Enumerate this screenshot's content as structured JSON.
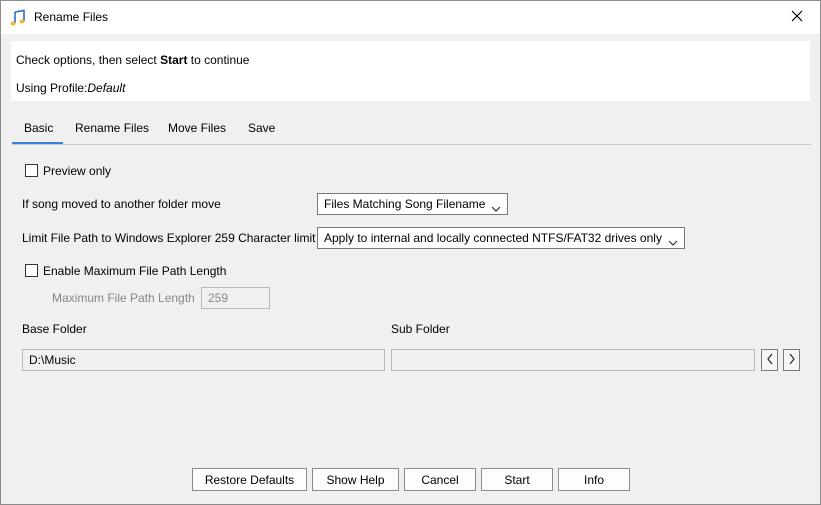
{
  "window": {
    "title": "Rename Files",
    "icon": "music-note-icon"
  },
  "header": {
    "instruction_pre": "Check options, then select ",
    "instruction_bold": "Start",
    "instruction_post": " to continue",
    "profile_label": "Using Profile:",
    "profile_value": "Default"
  },
  "tabs": [
    {
      "label": "Basic",
      "active": true
    },
    {
      "label": "Rename Files",
      "active": false
    },
    {
      "label": "Move Files",
      "active": false
    },
    {
      "label": "Save",
      "active": false
    }
  ],
  "basic": {
    "preview_only": {
      "label": "Preview only",
      "checked": false
    },
    "song_moved": {
      "label": "If song moved to another folder move",
      "selected": "Files Matching Song Filename"
    },
    "limit_path": {
      "label": "Limit File Path to Windows Explorer 259 Character limit",
      "selected": "Apply to internal and locally connected NTFS/FAT32 drives only"
    },
    "enable_max": {
      "label": "Enable Maximum File Path Length",
      "checked": false
    },
    "max_length": {
      "label": "Maximum File Path Length",
      "value": "259"
    },
    "base_folder": {
      "label": "Base Folder",
      "value": "D:\\Music"
    },
    "sub_folder": {
      "label": "Sub Folder",
      "value": ""
    }
  },
  "buttons": {
    "restore_defaults": "Restore Defaults",
    "show_help": "Show Help",
    "cancel": "Cancel",
    "start": "Start",
    "info": "Info"
  },
  "colors": {
    "accent": "#3b7dd8",
    "background": "#f0f0f0"
  }
}
